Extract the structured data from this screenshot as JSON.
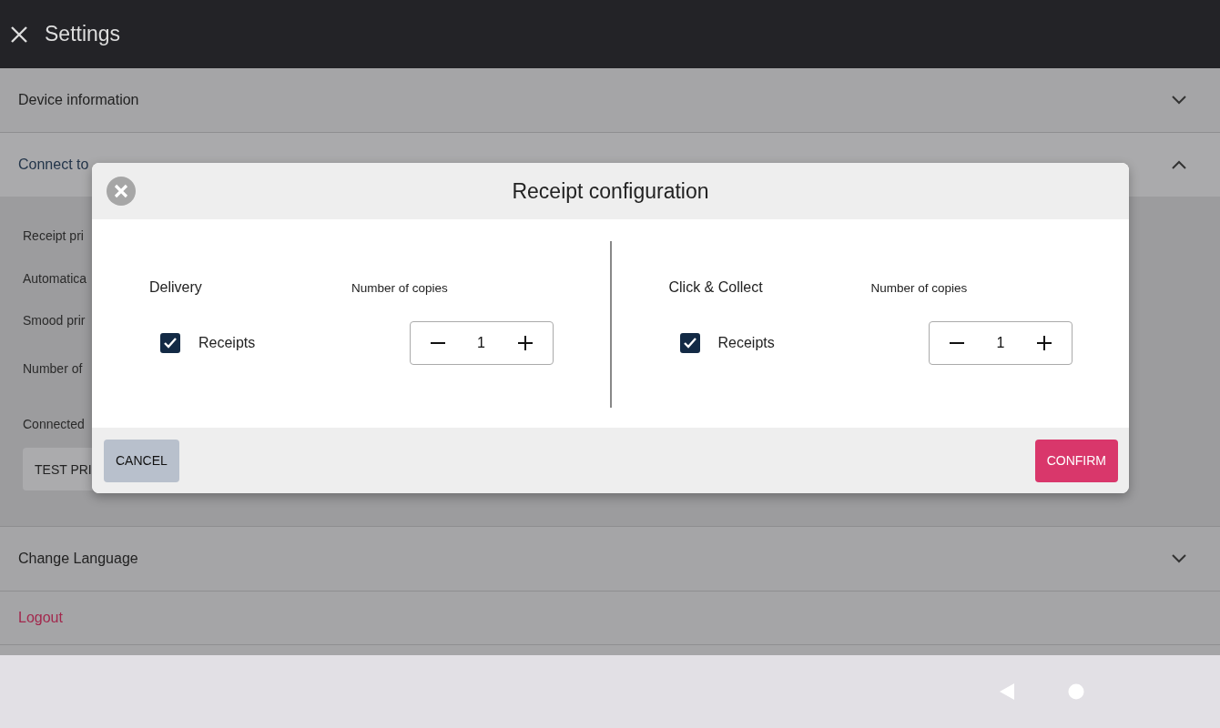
{
  "header": {
    "title": "Settings"
  },
  "sections": [
    {
      "kind": "accordion",
      "title": "Device information",
      "expanded": false
    },
    {
      "kind": "accordion",
      "title": "Connect to",
      "expanded": true,
      "items": [
        "Receipt pri",
        "Automatica",
        "Smood prir",
        "Number of",
        "Connected"
      ],
      "button": "TEST PRI"
    },
    {
      "kind": "accordion",
      "title": "Change Language",
      "expanded": false
    },
    {
      "kind": "link",
      "title": "Logout"
    }
  ],
  "dialog": {
    "title": "Receipt configuration",
    "columns": [
      {
        "title": "Delivery",
        "copies_label": "Number of copies",
        "option": {
          "label": "Receipts",
          "checked": true
        },
        "count": "1"
      },
      {
        "title": "Click & Collect",
        "copies_label": "Number of copies",
        "option": {
          "label": "Receipts",
          "checked": true
        },
        "count": "1"
      }
    ],
    "cancel": "CANCEL",
    "confirm": "CONFIRM"
  }
}
